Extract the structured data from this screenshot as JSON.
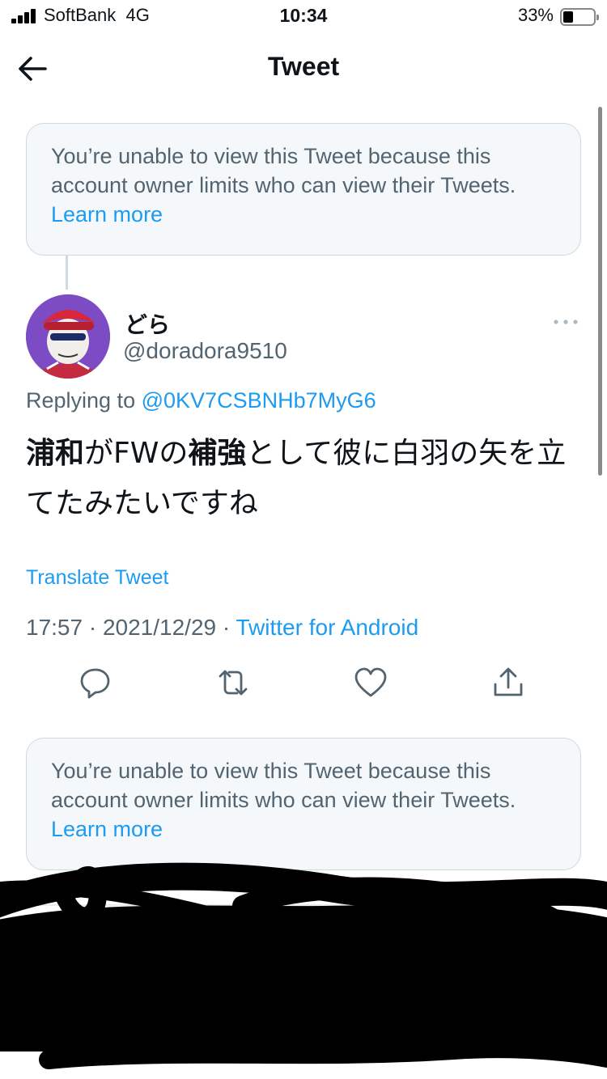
{
  "status_bar": {
    "carrier": "SoftBank",
    "network": "4G",
    "time": "10:34",
    "battery_percent": "33%"
  },
  "header": {
    "title": "Tweet"
  },
  "notices": {
    "first": {
      "text": "You’re unable to view this Tweet because this account owner limits who can view their Tweets.",
      "link": "Learn more"
    },
    "second": {
      "text": "You’re unable to view this Tweet because this account owner limits who can view their Tweets.",
      "link": "Learn more"
    }
  },
  "tweet": {
    "display_name": "どら",
    "handle": "@doradora9510",
    "replying_prefix": "Replying to",
    "replying_to": "@0KV7CSBNHb7MyG6",
    "text_bold_1": "浦和",
    "text_part_2": "がFWの",
    "text_bold_3": "補強",
    "text_part_4": "として彼に白羽の矢を立てたみたいですね",
    "translate_label": "Translate Tweet",
    "time": "17:57",
    "date": "2021/12/29",
    "source": "Twitter for Android"
  },
  "icons": {
    "back": "arrow-left-icon",
    "more": "more-horizontal-icon",
    "reply": "reply-icon",
    "retweet": "retweet-icon",
    "like": "heart-icon",
    "share": "share-icon"
  },
  "colors": {
    "link": "#1d9bf0",
    "secondary_text": "#536471",
    "notice_bg": "#f5f8fa"
  }
}
